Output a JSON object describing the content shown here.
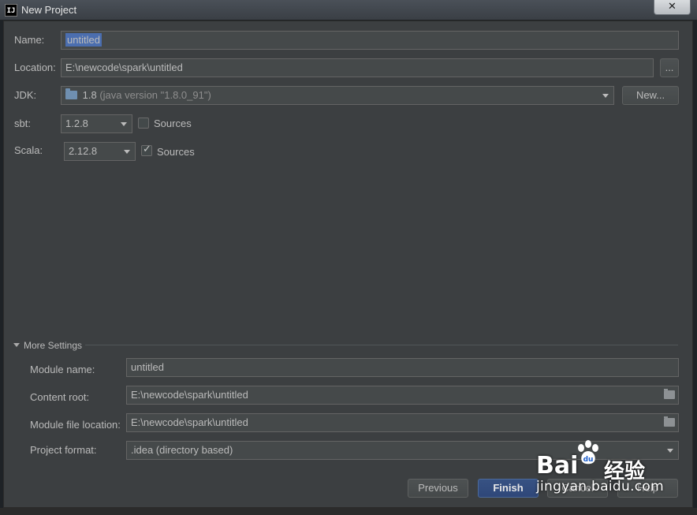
{
  "window": {
    "title": "New Project",
    "app_icon_text": "IJ",
    "close_glyph": "✕"
  },
  "form": {
    "name_label": "Name:",
    "name_value": "untitled",
    "location_label": "Location:",
    "location_value": "E:\\newcode\\spark\\untitled",
    "browse_label": "...",
    "jdk_label": "JDK:",
    "jdk_version": "1.8",
    "jdk_detail": "(java version \"1.8.0_91\")",
    "new_button": "New...",
    "sbt_label": "sbt:",
    "sbt_version": "1.2.8",
    "sbt_sources_label": "Sources",
    "sbt_sources_checked": false,
    "scala_label": "Scala:",
    "scala_version": "2.12.8",
    "scala_sources_label": "Sources",
    "scala_sources_checked": true
  },
  "more_settings": {
    "toggle_label": "More Settings",
    "module_name_label": "Module name:",
    "module_name_value": "untitled",
    "content_root_label": "Content root:",
    "content_root_value": "E:\\newcode\\spark\\untitled",
    "module_file_label": "Module file location:",
    "module_file_value": "E:\\newcode\\spark\\untitled",
    "project_format_label": "Project format:",
    "project_format_value": ".idea (directory based)"
  },
  "buttons": {
    "previous": "Previous",
    "finish": "Finish",
    "cancel": "Cancel",
    "help": "Help"
  },
  "watermark": {
    "brand_a": "Bai",
    "brand_b": "du",
    "brand_c": "经验",
    "url": "jingyan.baidu.com"
  },
  "colors": {
    "dialog_bg": "#3c3f41",
    "field_bg": "#45494a",
    "selection": "#4b6eaf",
    "primary_button": "#365880"
  }
}
